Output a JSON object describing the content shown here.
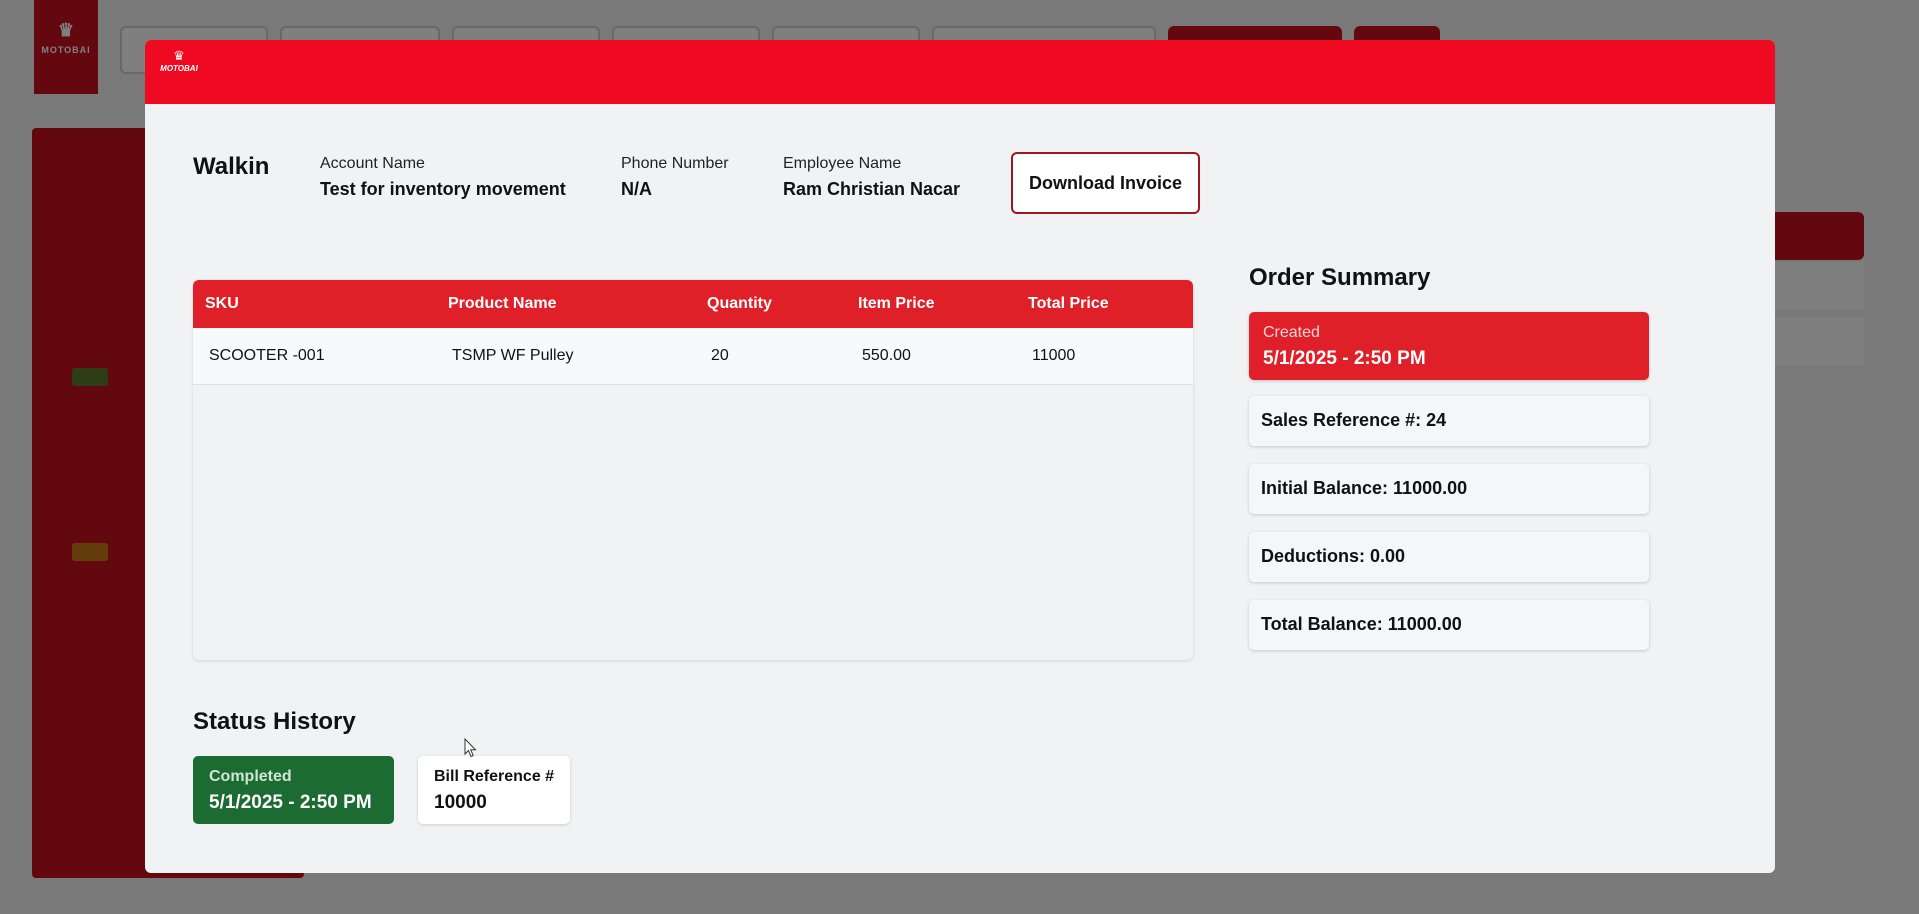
{
  "brand": {
    "name": "MOTOBAI"
  },
  "modal": {
    "customer_type": "Walkin",
    "account": {
      "label": "Account Name",
      "value": "Test for inventory movement"
    },
    "phone": {
      "label": "Phone Number",
      "value": "N/A"
    },
    "employee": {
      "label": "Employee Name",
      "value": "Ram Christian Nacar"
    },
    "download_label": "Download Invoice"
  },
  "table": {
    "headers": [
      "SKU",
      "Product Name",
      "Quantity",
      "Item Price",
      "Total Price"
    ],
    "rows": [
      [
        "SCOOTER -001",
        "TSMP WF Pulley",
        "20",
        "550.00",
        "11000"
      ]
    ]
  },
  "summary": {
    "title": "Order Summary",
    "created_label": "Created",
    "created_value": "5/1/2025 - 2:50 PM",
    "sales_reference": "Sales Reference #: 24",
    "initial_balance": "Initial Balance: 11000.00",
    "deductions": "Deductions: 0.00",
    "total_balance": "Total Balance: 11000.00"
  },
  "status_history": {
    "title": "Status History",
    "completed_label": "Completed",
    "completed_value": "5/1/2025 - 2:50 PM",
    "bill_label": "Bill Reference #",
    "bill_value": "10000"
  },
  "colors": {
    "header_red": "#f00a21",
    "table_red": "#e02028",
    "completed_green": "#1c6b33"
  },
  "icons": {
    "cursor": "arrow-cursor-icon",
    "logo": "motorcycle-logo-icon"
  }
}
